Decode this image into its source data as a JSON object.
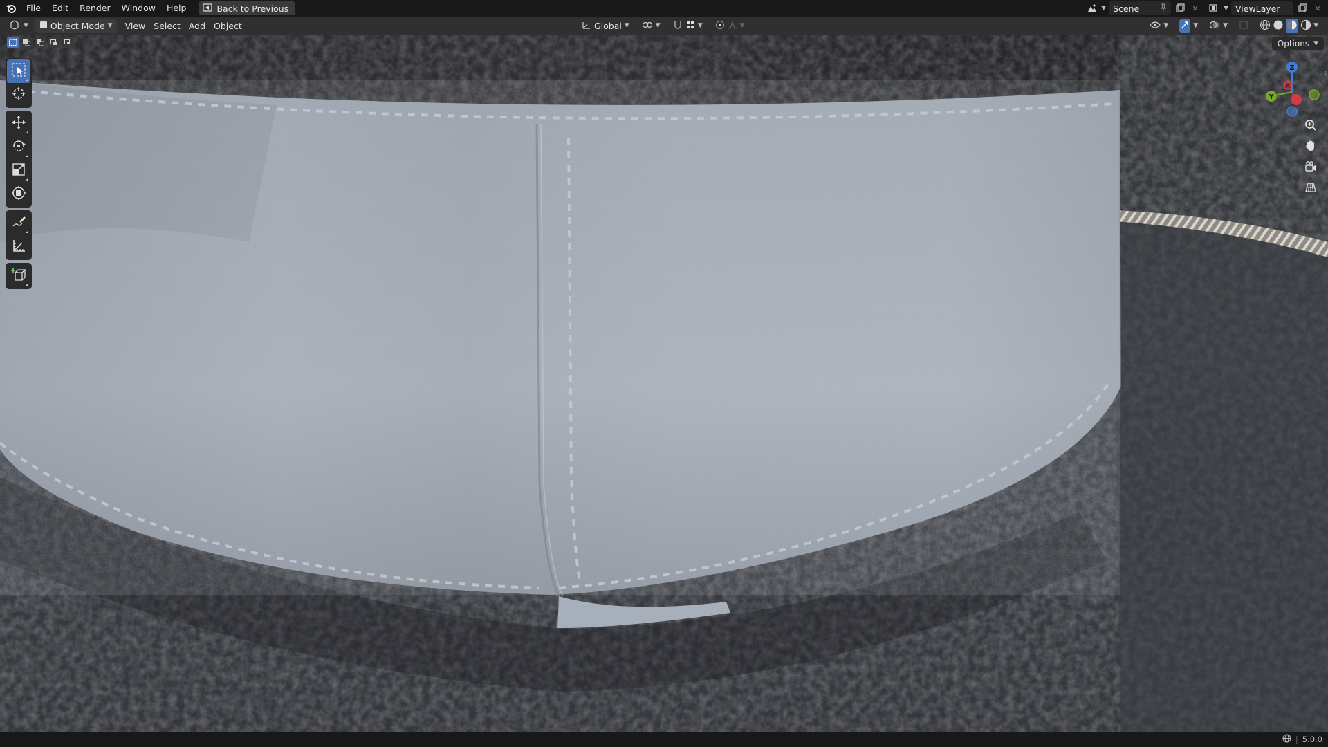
{
  "menu": {
    "items": [
      "File",
      "Edit",
      "Render",
      "Window",
      "Help"
    ],
    "back_button": "Back to Previous"
  },
  "top_right": {
    "scene": "Scene",
    "view_layer": "ViewLayer"
  },
  "header": {
    "mode": "Object Mode",
    "menus": [
      "View",
      "Select",
      "Add",
      "Object"
    ],
    "transform_orientation": "Global"
  },
  "viewport": {
    "options_label": "Options",
    "gizmo_axes": {
      "z": "Z",
      "y": "Y",
      "x": "X"
    },
    "axis_colors": {
      "x": "#d63a4a",
      "y": "#7aa62a",
      "z": "#3f7dd6"
    }
  },
  "status": {
    "version": "5.0.0"
  },
  "colors": {
    "accent": "#4772b3",
    "menubar": "#181818",
    "header": "#303030"
  }
}
